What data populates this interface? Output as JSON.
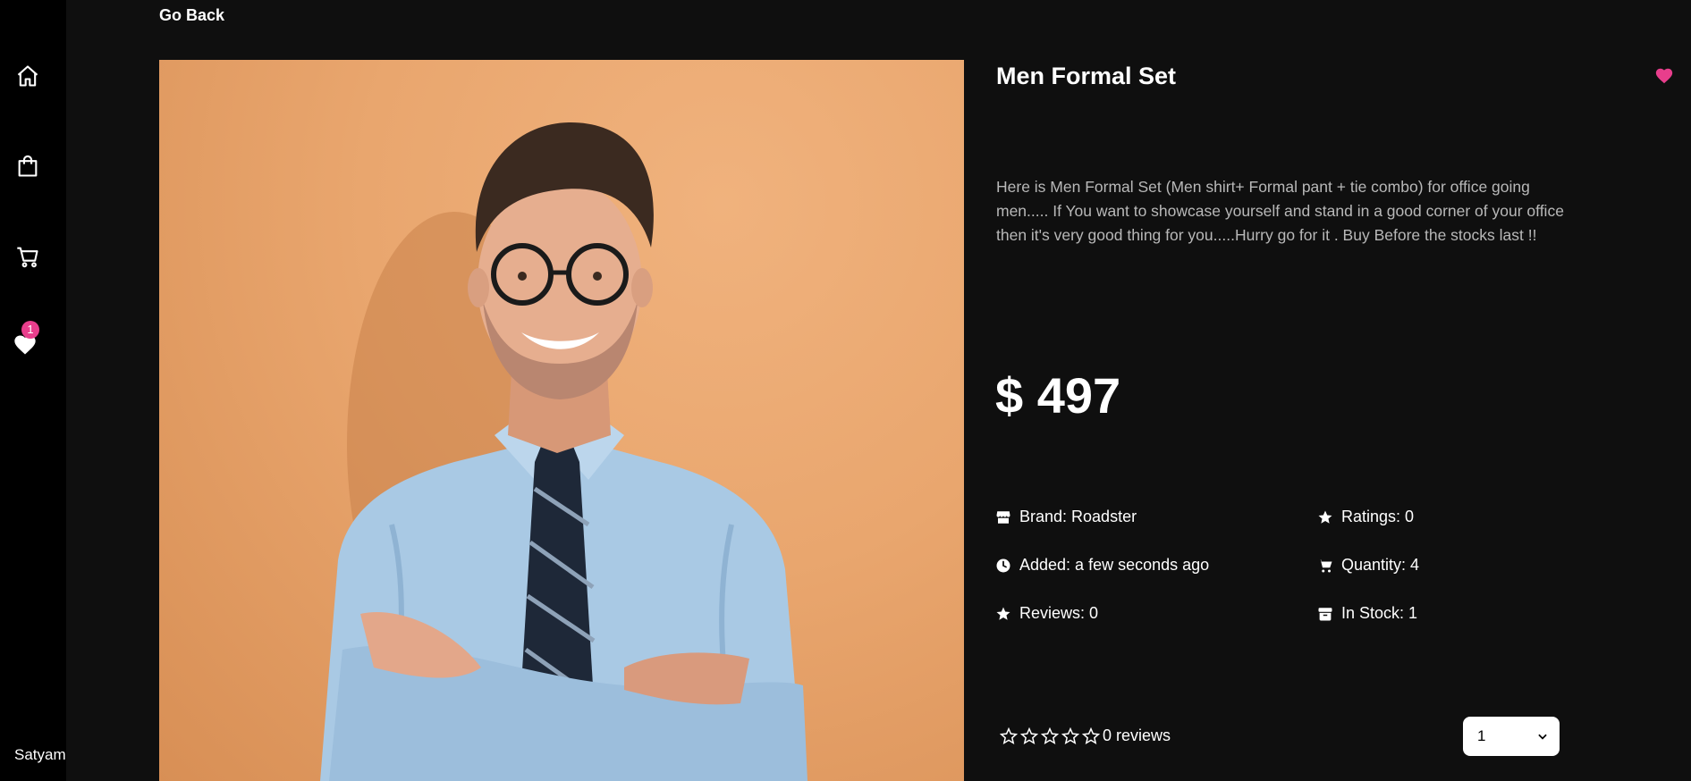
{
  "nav": {
    "items": [
      {
        "icon": "home-icon"
      },
      {
        "icon": "shopping-bag-icon"
      },
      {
        "icon": "cart-icon"
      },
      {
        "icon": "heart-icon",
        "badge": "1"
      }
    ],
    "username": "Satyam"
  },
  "header": {
    "go_back_label": "Go Back"
  },
  "product": {
    "title": "Men Formal Set",
    "description": "Here is Men Formal Set (Men shirt+ Formal pant + tie combo) for office going men..... If You want to showcase yourself and stand in a good corner of your office then it's very good thing for you.....Hurry go for it . Buy Before the stocks last !!",
    "price": "$ 497",
    "brand": "Brand: Roadster",
    "added": "Added: a few seconds ago",
    "reviews": "Reviews: 0",
    "ratings": "Ratings: 0",
    "quantity": "Quantity: 4",
    "in_stock": "In Stock: 1",
    "review_summary": "0 reviews",
    "rating_stars": 0,
    "selected_quantity": "1"
  },
  "colors": {
    "accent": "#e83e8c",
    "background": "#0f0f0f",
    "sidebar": "#000000"
  }
}
